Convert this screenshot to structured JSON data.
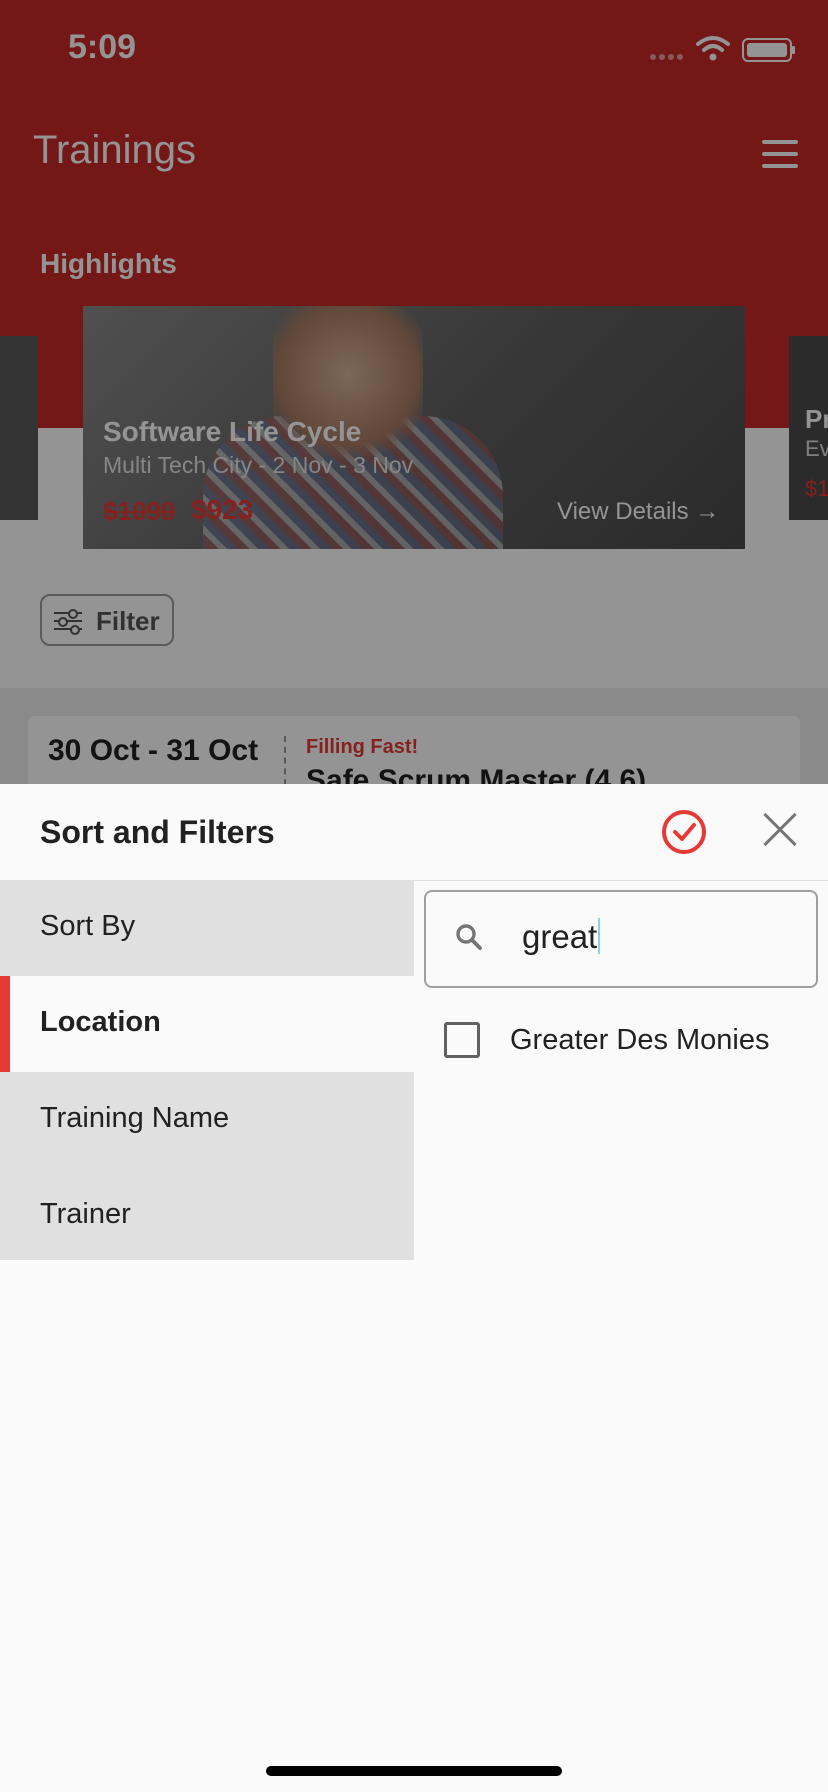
{
  "status_bar": {
    "time": "5:09"
  },
  "app": {
    "title": "Trainings",
    "section_title": "Highlights",
    "highlight_card": {
      "title": "Software Life Cycle",
      "subtitle": "Multi Tech City - 2 Nov - 3 Nov",
      "old_price": "$1090",
      "new_price": "$923",
      "details_label": "View Details →"
    },
    "next_card": {
      "title": "Pr",
      "subtitle": "Ev",
      "price": "$1"
    },
    "filter_button": "Filter",
    "list_item": {
      "date": "30 Oct - 31 Oct",
      "tag": "Filling Fast!",
      "name": "Safe Scrum Master (4.6)"
    }
  },
  "sheet": {
    "title": "Sort and Filters",
    "apply_icon": "check-circle-icon",
    "close_icon": "close-icon",
    "categories": [
      {
        "label": "Sort By",
        "active": false
      },
      {
        "label": "Location",
        "active": true
      },
      {
        "label": "Training Name",
        "active": false
      },
      {
        "label": "Trainer",
        "active": false
      }
    ],
    "search": {
      "value": "great",
      "placeholder": ""
    },
    "options": [
      {
        "label": "Greater Des Monies",
        "checked": false
      }
    ]
  },
  "colors": {
    "brand_red": "#c62828",
    "accent_red": "#e53935"
  }
}
